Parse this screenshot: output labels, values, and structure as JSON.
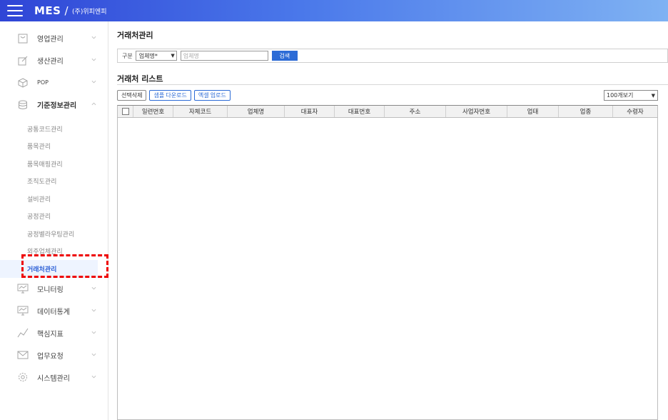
{
  "topbar": {
    "brand": "MES",
    "slash": "/",
    "company": "(주)위피엔피"
  },
  "sidebar": {
    "items": [
      {
        "label": "영업관리",
        "icon": "shopping-bag-icon"
      },
      {
        "label": "생산관리",
        "icon": "edit-icon"
      },
      {
        "label": "POP",
        "icon": "cube-icon"
      },
      {
        "label": "기준정보관리",
        "icon": "database-icon"
      }
    ],
    "submenu": [
      "공통코드관리",
      "품목관리",
      "품목매핑관리",
      "조직도관리",
      "설비관리",
      "공정관리",
      "공정별라우팅관리",
      "외주업체관리",
      "거래처관리"
    ],
    "active_sub": "거래처관리",
    "items_after": [
      {
        "label": "모니터링",
        "icon": "monitor-icon"
      },
      {
        "label": "데이터통계",
        "icon": "monitor-stats-icon"
      },
      {
        "label": "핵심지표",
        "icon": "line-chart-icon"
      },
      {
        "label": "업무요청",
        "icon": "mail-icon"
      },
      {
        "label": "시스템관리",
        "icon": "gear-icon"
      }
    ]
  },
  "main": {
    "title": "거래처관리",
    "search": {
      "label": "구분",
      "select_value": "업체명*",
      "input_placeholder": "업체명",
      "button": "검색"
    },
    "list_title": "거래처 리스트",
    "buttons": {
      "delete": "선택삭제",
      "sample": "샘플 다운로드",
      "excel": "엑셀 업로드"
    },
    "page_size": "100개보기",
    "columns": [
      "일련번호",
      "자체코드",
      "업체명",
      "대표자",
      "대표번호",
      "주소",
      "사업자번호",
      "업태",
      "업종",
      "수령자"
    ]
  },
  "colors": {
    "accent": "#2c6bd6",
    "highlight": "#e00000",
    "topbar_start": "#2f45d6",
    "topbar_end": "#7fb2f3"
  }
}
